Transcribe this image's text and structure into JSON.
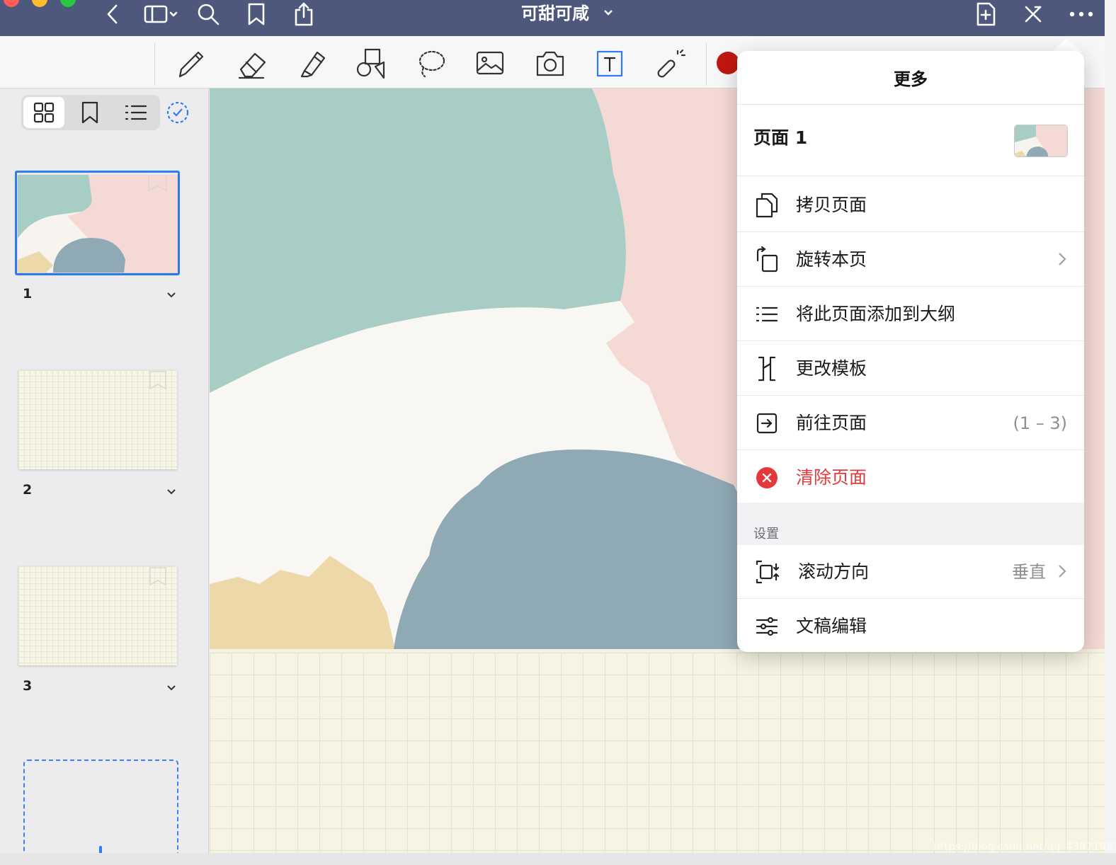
{
  "titlebar": {
    "traffic_lights": {
      "close": "#ff5f57",
      "minimize": "#febc2e",
      "zoom": "#28c840"
    },
    "icons": [
      "back-chevron-icon",
      "sidebar-toggle-icon",
      "search-icon",
      "bookmark-icon",
      "share-icon",
      "add-page-icon",
      "close-edit-icon",
      "more-icon"
    ],
    "document_title": "可甜可咸"
  },
  "toolbar": {
    "tools": [
      "pen-icon",
      "eraser-icon",
      "highlighter-icon",
      "shapes-icon",
      "lasso-icon",
      "image-icon",
      "camera-icon",
      "textbox-icon",
      "laser-pointer-icon"
    ],
    "active_tool": "textbox-icon",
    "current_color": "#c0170f"
  },
  "sidebar": {
    "view_modes": [
      "thumbnails-grid-icon",
      "bookmarks-icon",
      "outline-list-icon"
    ],
    "selected_view": "thumbnails-grid-icon",
    "thumbnails": [
      {
        "number": "1",
        "selected": true
      },
      {
        "number": "2",
        "selected": false
      },
      {
        "number": "3",
        "selected": false
      }
    ]
  },
  "popover": {
    "title": "更多",
    "page_label": "页面 1",
    "items": [
      {
        "icon": "copy-page-icon",
        "label": "拷贝页面",
        "value": "",
        "chevron": false
      },
      {
        "icon": "rotate-page-icon",
        "label": "旋转本页",
        "value": "",
        "chevron": true
      },
      {
        "icon": "outline-add-icon",
        "label": "将此页面添加到大纲",
        "value": "",
        "chevron": false
      },
      {
        "icon": "change-template-icon",
        "label": "更改模板",
        "value": "",
        "chevron": false
      },
      {
        "icon": "go-to-page-icon",
        "label": "前往页面",
        "value": "(1 – 3)",
        "chevron": false
      },
      {
        "icon": "clear-page-icon",
        "label": "清除页面",
        "value": "",
        "chevron": false
      }
    ],
    "settings_header": "设置",
    "settings": [
      {
        "icon": "scroll-direction-icon",
        "label": "滚动方向",
        "value": "垂直",
        "chevron": true
      },
      {
        "icon": "document-edit-icon",
        "label": "文稿编辑",
        "value": "",
        "chevron": false
      }
    ],
    "danger_color": "#e5383b"
  },
  "watermark": "https://blog.csdn.net/qq_43871995"
}
